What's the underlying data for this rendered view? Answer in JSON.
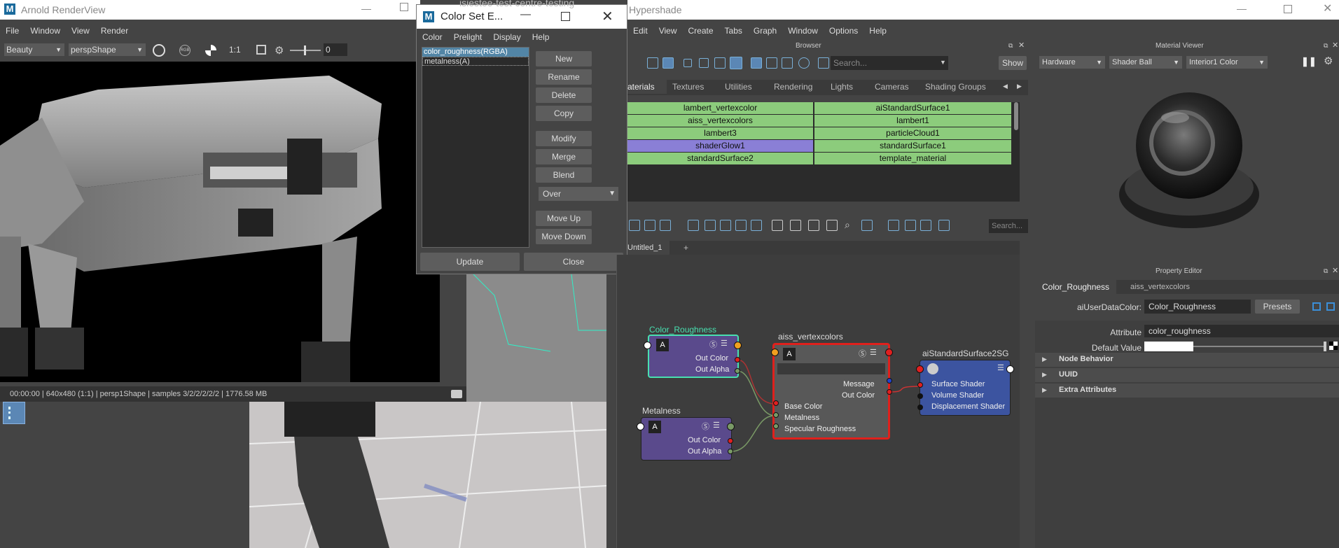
{
  "arnold": {
    "title": "Arnold RenderView",
    "menus": [
      "File",
      "Window",
      "View",
      "Render"
    ],
    "aov": "Beauty",
    "camera": "perspShape",
    "ratio": "1:1",
    "exposure": "0",
    "status": "00:00:00 | 640x480 (1:1) | persp1Shape  | samples 3/2/2/2/2/2 | 1776.58 MB"
  },
  "colorset": {
    "title": "Color Set E...",
    "menus": [
      "Color",
      "Prelight",
      "Display",
      "Help"
    ],
    "sets": [
      "color_roughness(RGBA)",
      "metalness(A)"
    ],
    "buttons": [
      "New",
      "Rename",
      "Delete",
      "Copy",
      "Modify",
      "Merge",
      "Blend"
    ],
    "blend_mode": "Over",
    "move_up": "Move Up",
    "move_down": "Move Down",
    "update": "Update",
    "close": "Close"
  },
  "hypershade": {
    "title": "Hypershade",
    "bg_title": "isiestee-test-centre-testing",
    "menus": [
      "Edit",
      "View",
      "Create",
      "Tabs",
      "Graph",
      "Window",
      "Options",
      "Help"
    ],
    "browser_title": "Browser",
    "search_placeholder": "Search...",
    "show_label": "Show",
    "browser_tabs": [
      "aterials",
      "Textures",
      "Utilities",
      "Rendering",
      "Lights",
      "Cameras",
      "Shading Groups"
    ],
    "materials_left": [
      "lambert_vertexcolor",
      "aiss_vertexcolors",
      "lambert3",
      "shaderGlow1",
      "standardSurface2"
    ],
    "materials_right": [
      "aiStandardSurface1",
      "lambert1",
      "particleCloud1",
      "standardSurface1",
      "template_material"
    ],
    "graph_search": "Search...",
    "graph_tab": "Untitled_1",
    "graph_tab_add": "+"
  },
  "nodes": {
    "color_roughness": {
      "title": "Color_Roughness",
      "out_color": "Out Color",
      "out_alpha": "Out Alpha"
    },
    "metalness": {
      "title": "Metalness",
      "out_color": "Out Color",
      "out_alpha": "Out Alpha"
    },
    "aiss": {
      "title": "aiss_vertexcolors",
      "message": "Message",
      "out_color": "Out Color",
      "base_color": "Base Color",
      "metalness": "Metalness",
      "specular": "Specular Roughness"
    },
    "sg": {
      "title": "aiStandardSurface2SG",
      "surface": "Surface Shader",
      "volume": "Volume Shader",
      "displacement": "Displacement Shader"
    }
  },
  "material_viewer": {
    "title": "Material Viewer",
    "renderer": "Hardware",
    "shape": "Shader Ball",
    "env": "Interior1 Color"
  },
  "property_editor": {
    "title": "Property Editor",
    "tabs": [
      "Color_Roughness",
      "aiss_vertexcolors"
    ],
    "type_label": "aiUserDataColor:",
    "node_name": "Color_Roughness",
    "presets": "Presets",
    "attribute_label": "Attribute",
    "attribute_value": "color_roughness",
    "default_label": "Default Value",
    "sections": [
      "Node Behavior",
      "UUID",
      "Extra Attributes"
    ]
  },
  "colors": {
    "node_purple": "#5a4a8c",
    "node_blue": "#3c54a0",
    "mat_green": "#8ccc7c",
    "mat_selected": "#8a7fd6",
    "select_outline": "#48e0b0",
    "shader_outline": "#e0201c"
  }
}
